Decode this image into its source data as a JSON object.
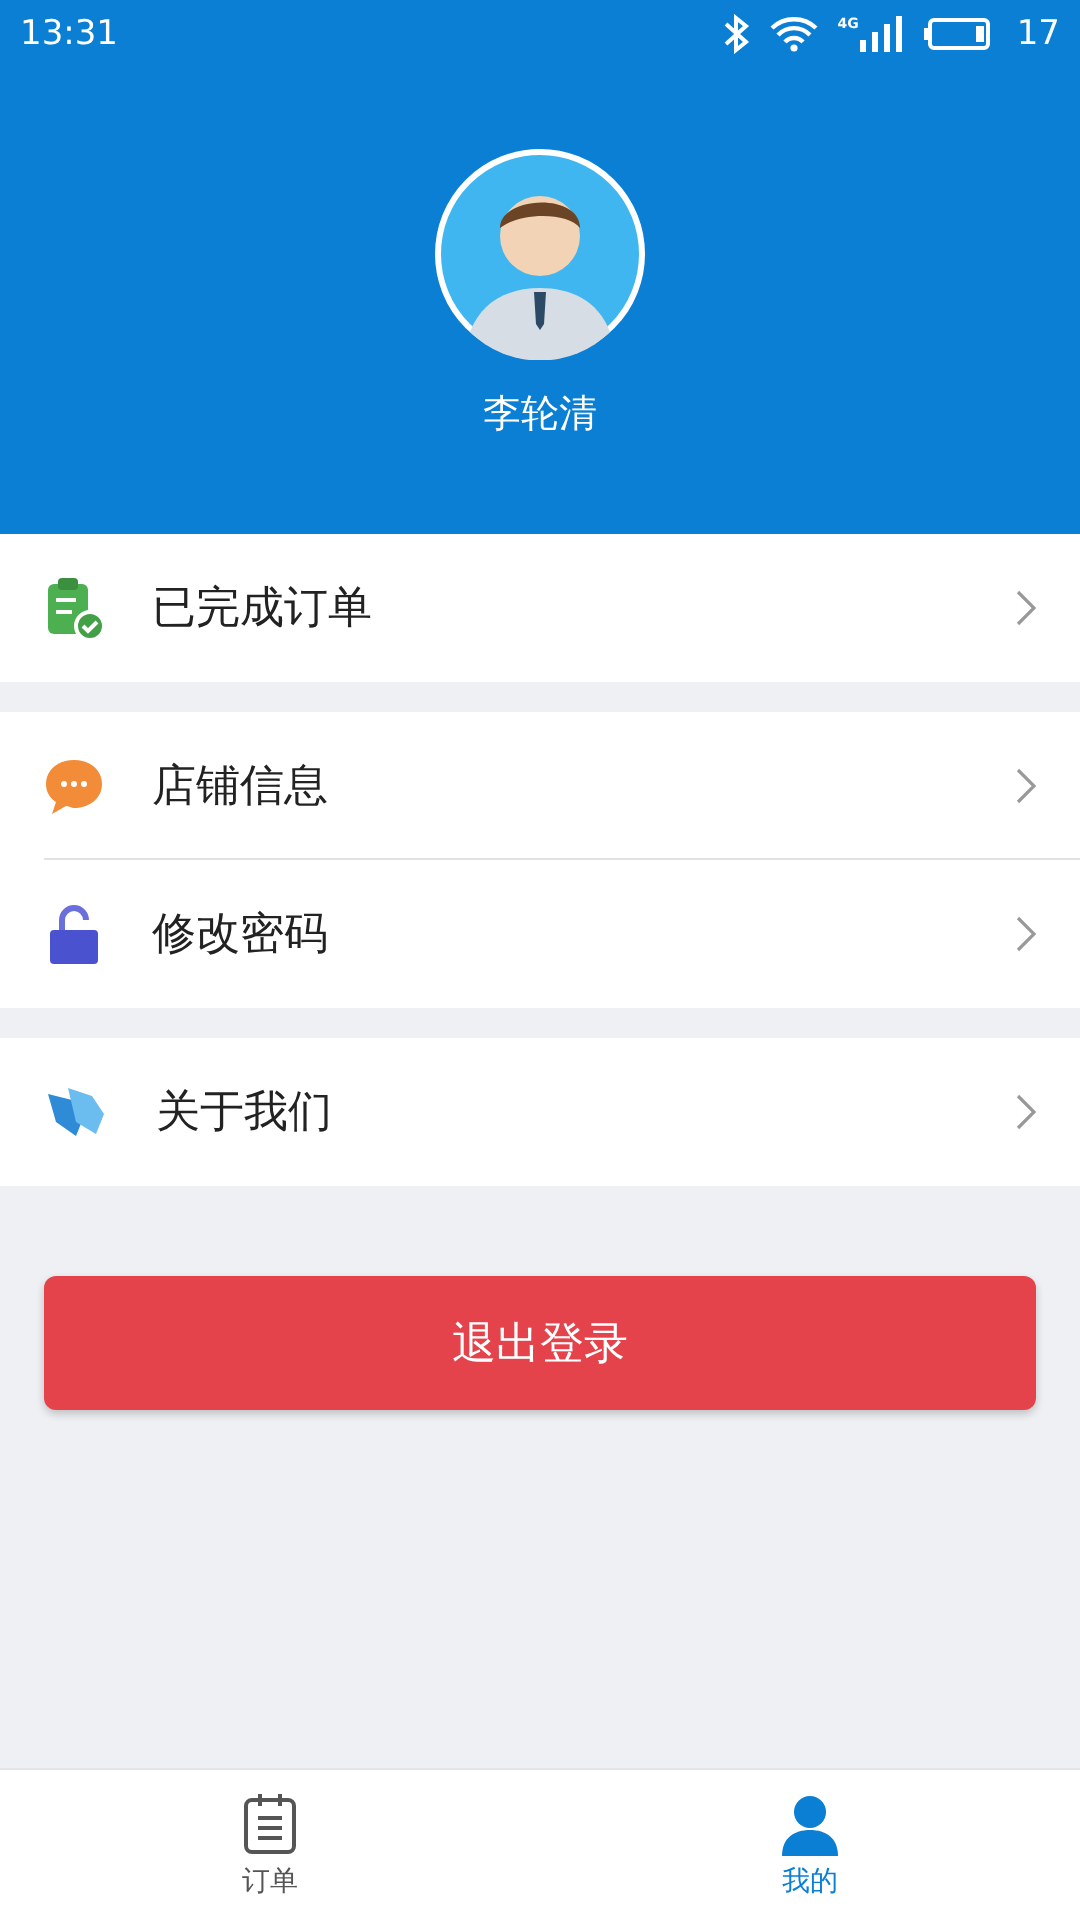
{
  "status_bar": {
    "time": "13:31",
    "network": "4G",
    "battery_text": "17"
  },
  "profile": {
    "name": "李轮清"
  },
  "menu_groups": [
    {
      "items": [
        {
          "kind": "clipboard",
          "label": "已完成订单"
        }
      ]
    },
    {
      "items": [
        {
          "kind": "chat",
          "label": "店铺信息"
        },
        {
          "kind": "lock",
          "label": "修改密码"
        }
      ]
    },
    {
      "items": [
        {
          "kind": "hands",
          "label": "关于我们"
        }
      ]
    }
  ],
  "logout_button": "退出登录",
  "tabs": [
    {
      "kind": "orders",
      "label": "订单",
      "selected": false
    },
    {
      "kind": "me",
      "label": "我的",
      "selected": true
    }
  ]
}
